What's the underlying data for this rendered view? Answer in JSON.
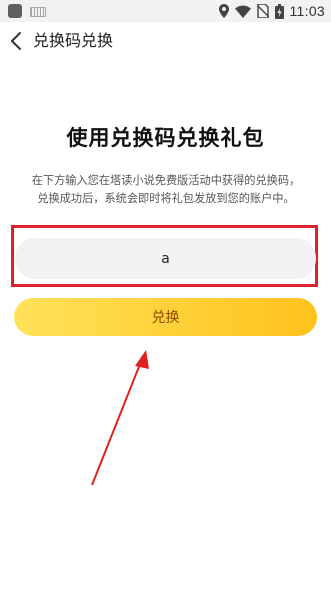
{
  "status_bar": {
    "time": "11:03",
    "icons": [
      "app-square-icon",
      "keyboard-icon",
      "location-icon",
      "wifi-icon",
      "no-sim-icon",
      "battery-icon"
    ]
  },
  "nav": {
    "back_icon": "chevron-left-icon",
    "title": "兑换码兑换"
  },
  "main": {
    "heading": "使用兑换码兑换礼包",
    "description_line1": "在下方输入您在塔读小说免费版活动中获得的兑换码，",
    "description_line2": "兑换成功后，系统会即时将礼包发放到您的账户中。",
    "code_input_value": "a",
    "redeem_label": "兑换"
  },
  "annotation": {
    "frame_color": "#d9252a",
    "arrow_color": "#e02020"
  },
  "colors": {
    "button_gradient_start": "#ffe15a",
    "button_gradient_end": "#ffc21c",
    "button_text": "#8a4a00",
    "input_bg": "#f2f2f2"
  }
}
